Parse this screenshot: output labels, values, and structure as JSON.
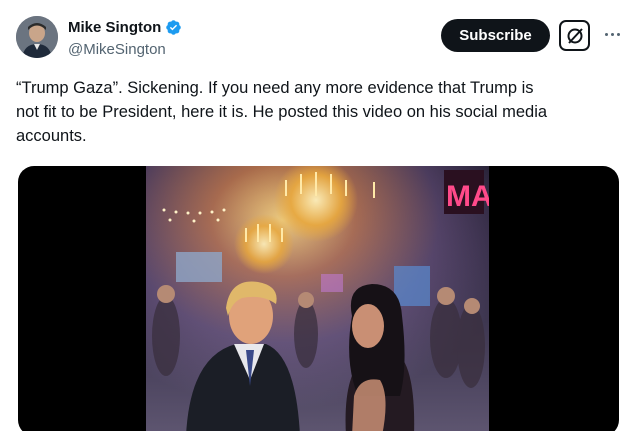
{
  "author": {
    "display_name": "Mike Sington",
    "handle": "@MikeSington",
    "verified": true
  },
  "actions": {
    "subscribe_label": "Subscribe",
    "grok_icon": "grok-icon",
    "more_icon": "more-horizontal-icon"
  },
  "tweet": {
    "text": "“Trump Gaza”. Sickening. If you need any more evidence that Trump is\nnot fit to be President, here it is. He posted this video on his social media\naccounts."
  },
  "media": {
    "type": "video",
    "sign_text": "MA"
  },
  "colors": {
    "text_primary": "#0f1419",
    "text_secondary": "#536471",
    "verified_blue": "#1d9bf0",
    "button_dark": "#0f1419"
  }
}
